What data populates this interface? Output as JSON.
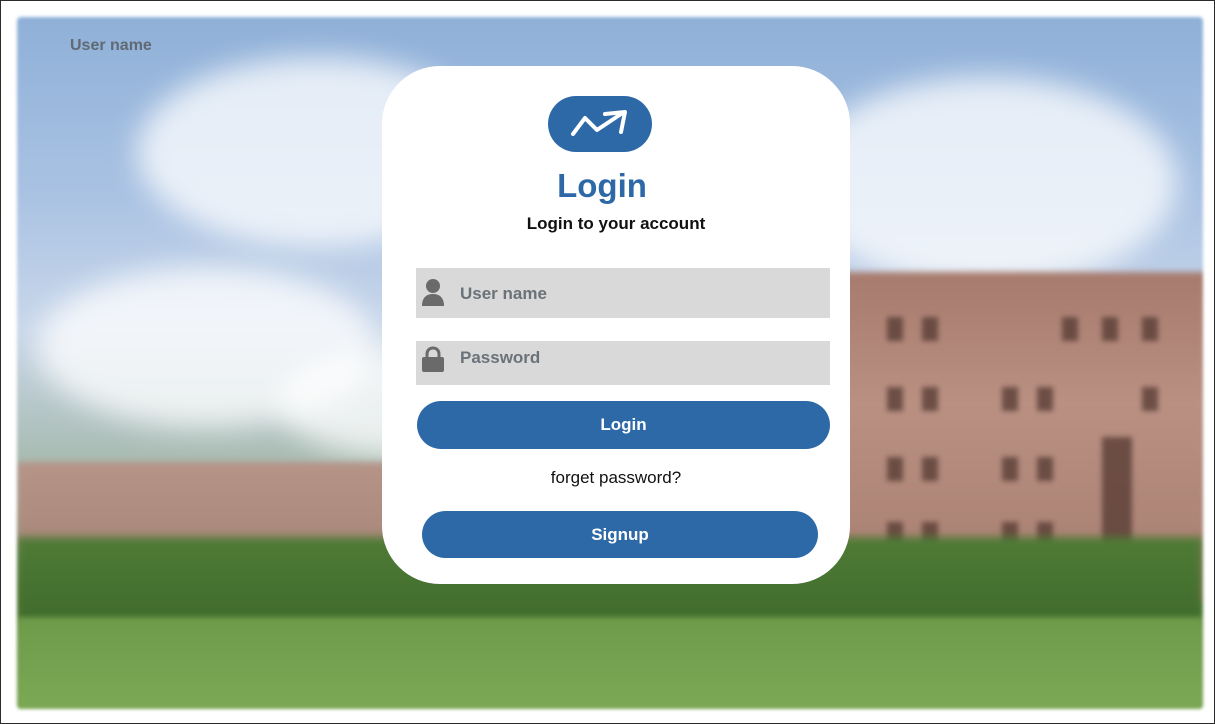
{
  "page": {
    "corner_label": "User name"
  },
  "login_card": {
    "title": "Login",
    "subtitle": "Login to your account",
    "username_placeholder": "User name",
    "password_placeholder": "Password",
    "login_button": "Login",
    "forgot_link": "forget password?",
    "signup_button": "Signup"
  },
  "icons": {
    "logo": "trend-arrow-icon",
    "username": "user-icon",
    "password": "lock-icon"
  },
  "colors": {
    "accent": "#2e69a7",
    "field_bg": "#d9d9d9",
    "card_bg": "#ffffff"
  }
}
